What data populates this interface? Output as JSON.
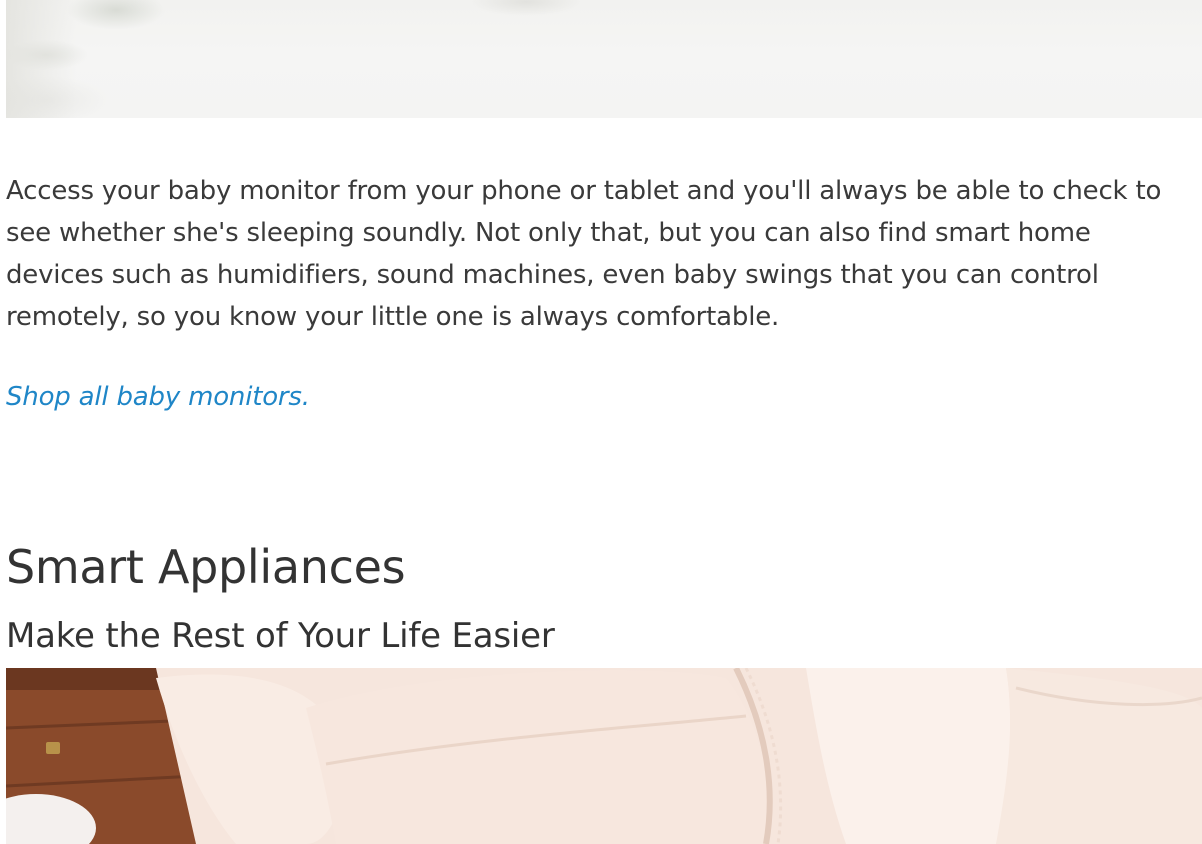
{
  "article": {
    "top_image": {
      "alt_icon": "photo-icon"
    },
    "paragraph": "Access your baby monitor from your phone or tablet and you'll always be able to check to see whether she's sleeping soundly. Not only that, but you can also find smart home devices such as humidifiers, sound machines, even baby swings that you can control remotely, so you know your little one is always comfortable.",
    "link_text": "Shop all baby monitors.",
    "section": {
      "title": "Smart Appliances",
      "subtitle": "Make the Rest of Your Life Easier"
    },
    "bottom_image": {
      "alt_icon": "photo-icon"
    }
  },
  "colors": {
    "text": "#333333",
    "link": "#1f86c7",
    "background": "#ffffff"
  }
}
